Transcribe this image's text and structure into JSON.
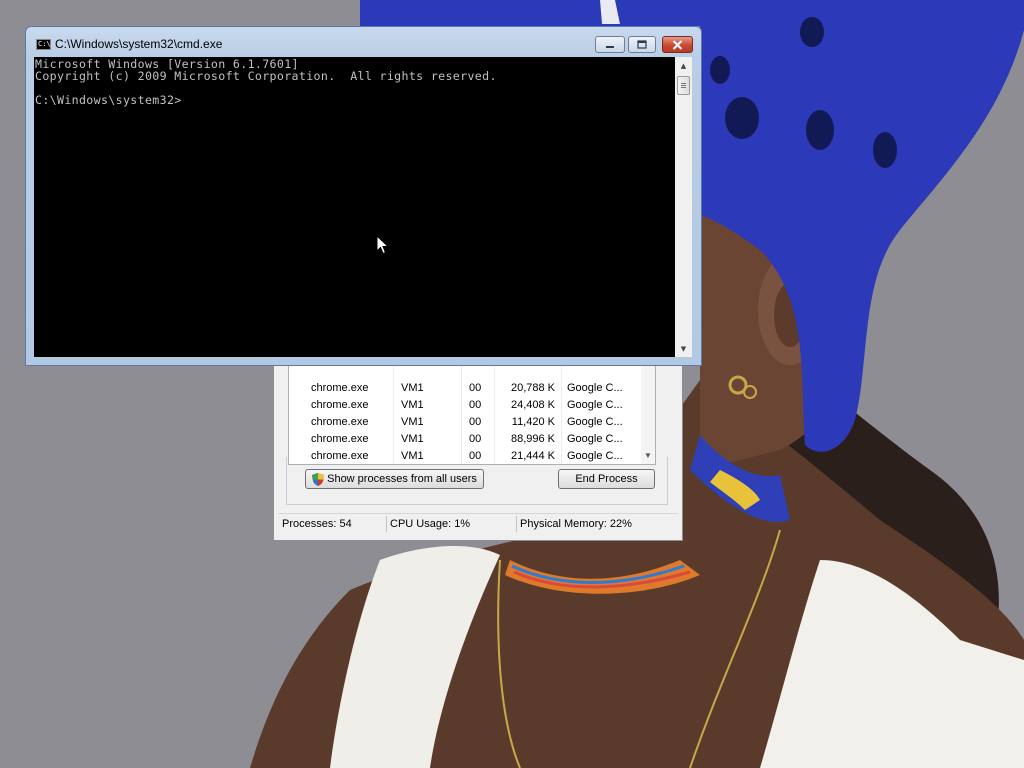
{
  "cmd_window": {
    "title": "C:\\Windows\\system32\\cmd.exe",
    "console_lines": [
      "Microsoft Windows [Version 6.1.7601]",
      "Copyright (c) 2009 Microsoft Corporation.  All rights reserved.",
      "",
      "C:\\Windows\\system32>"
    ]
  },
  "task_manager": {
    "processes": [
      {
        "name": "chrome.exe",
        "user": "VM1",
        "cpu": "00",
        "memory": "20,788 K",
        "description": "Google C..."
      },
      {
        "name": "chrome.exe",
        "user": "VM1",
        "cpu": "00",
        "memory": "24,408 K",
        "description": "Google C..."
      },
      {
        "name": "chrome.exe",
        "user": "VM1",
        "cpu": "00",
        "memory": "11,420 K",
        "description": "Google C..."
      },
      {
        "name": "chrome.exe",
        "user": "VM1",
        "cpu": "00",
        "memory": "88,996 K",
        "description": "Google C..."
      },
      {
        "name": "chrome.exe",
        "user": "VM1",
        "cpu": "00",
        "memory": "21,444 K",
        "description": "Google C..."
      }
    ],
    "show_all_users_label": "Show processes from all users",
    "end_process_label": "End Process",
    "status": {
      "processes": "Processes: 54",
      "cpu_usage": "CPU Usage: 1%",
      "physical_memory": "Physical Memory: 22%"
    }
  },
  "icons": {
    "cmd_app": "command-prompt-icon",
    "minimize": "minimize-icon",
    "maximize": "maximize-icon",
    "close": "close-icon",
    "uac_shield": "uac-shield-icon",
    "cursor": "mouse-pointer-icon"
  },
  "colors": {
    "console_bg": "#000000",
    "console_text": "#c0c0c0",
    "close_button": "#c84a33",
    "helmet": "#2c39b8"
  }
}
